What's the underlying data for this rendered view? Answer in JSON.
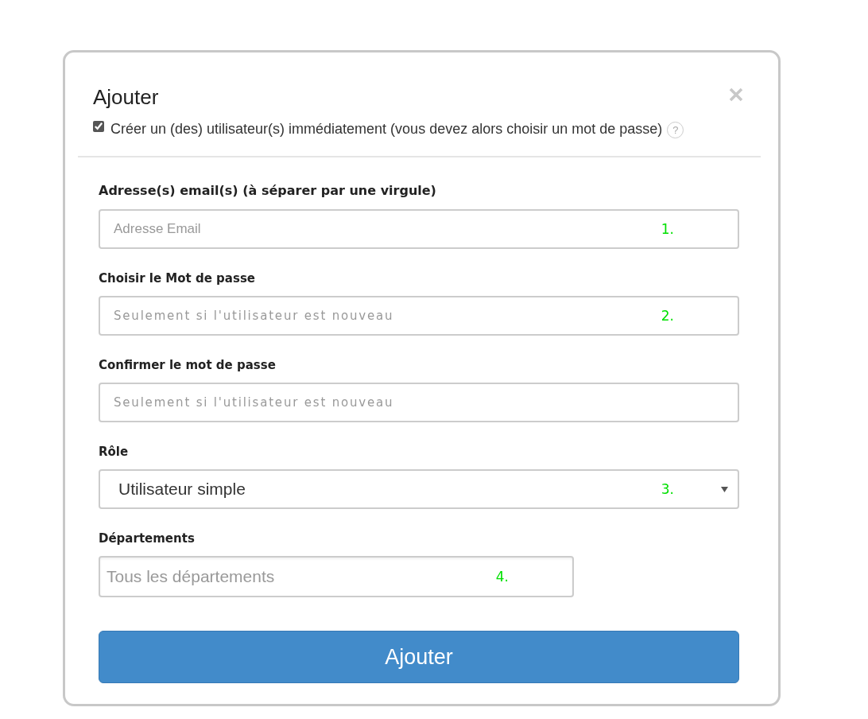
{
  "dialog": {
    "title": "Ajouter",
    "create_now": {
      "label": "Créer un (des) utilisateur(s) immédiatement (vous devez alors choisir un mot de passe)",
      "checked": true,
      "help": "?"
    }
  },
  "fields": [
    {
      "kind": "text",
      "label": "Adresse(s) email(s) (à séparer par une virgule)",
      "placeholder": "Adresse Email",
      "marker": "1."
    },
    {
      "kind": "password",
      "label": "Choisir le Mot de passe",
      "placeholder": "Seulement si l'utilisateur est nouveau",
      "marker": "2."
    },
    {
      "kind": "password",
      "label": "Confirmer le mot de passe",
      "placeholder": "Seulement si l'utilisateur est nouveau"
    },
    {
      "kind": "select",
      "label": "Rôle",
      "value": "Utilisateur simple",
      "marker": "3."
    },
    {
      "kind": "tags",
      "label": "Départements",
      "placeholder": "Tous les départements",
      "marker": "4."
    }
  ],
  "submit": {
    "label": "Ajouter"
  }
}
